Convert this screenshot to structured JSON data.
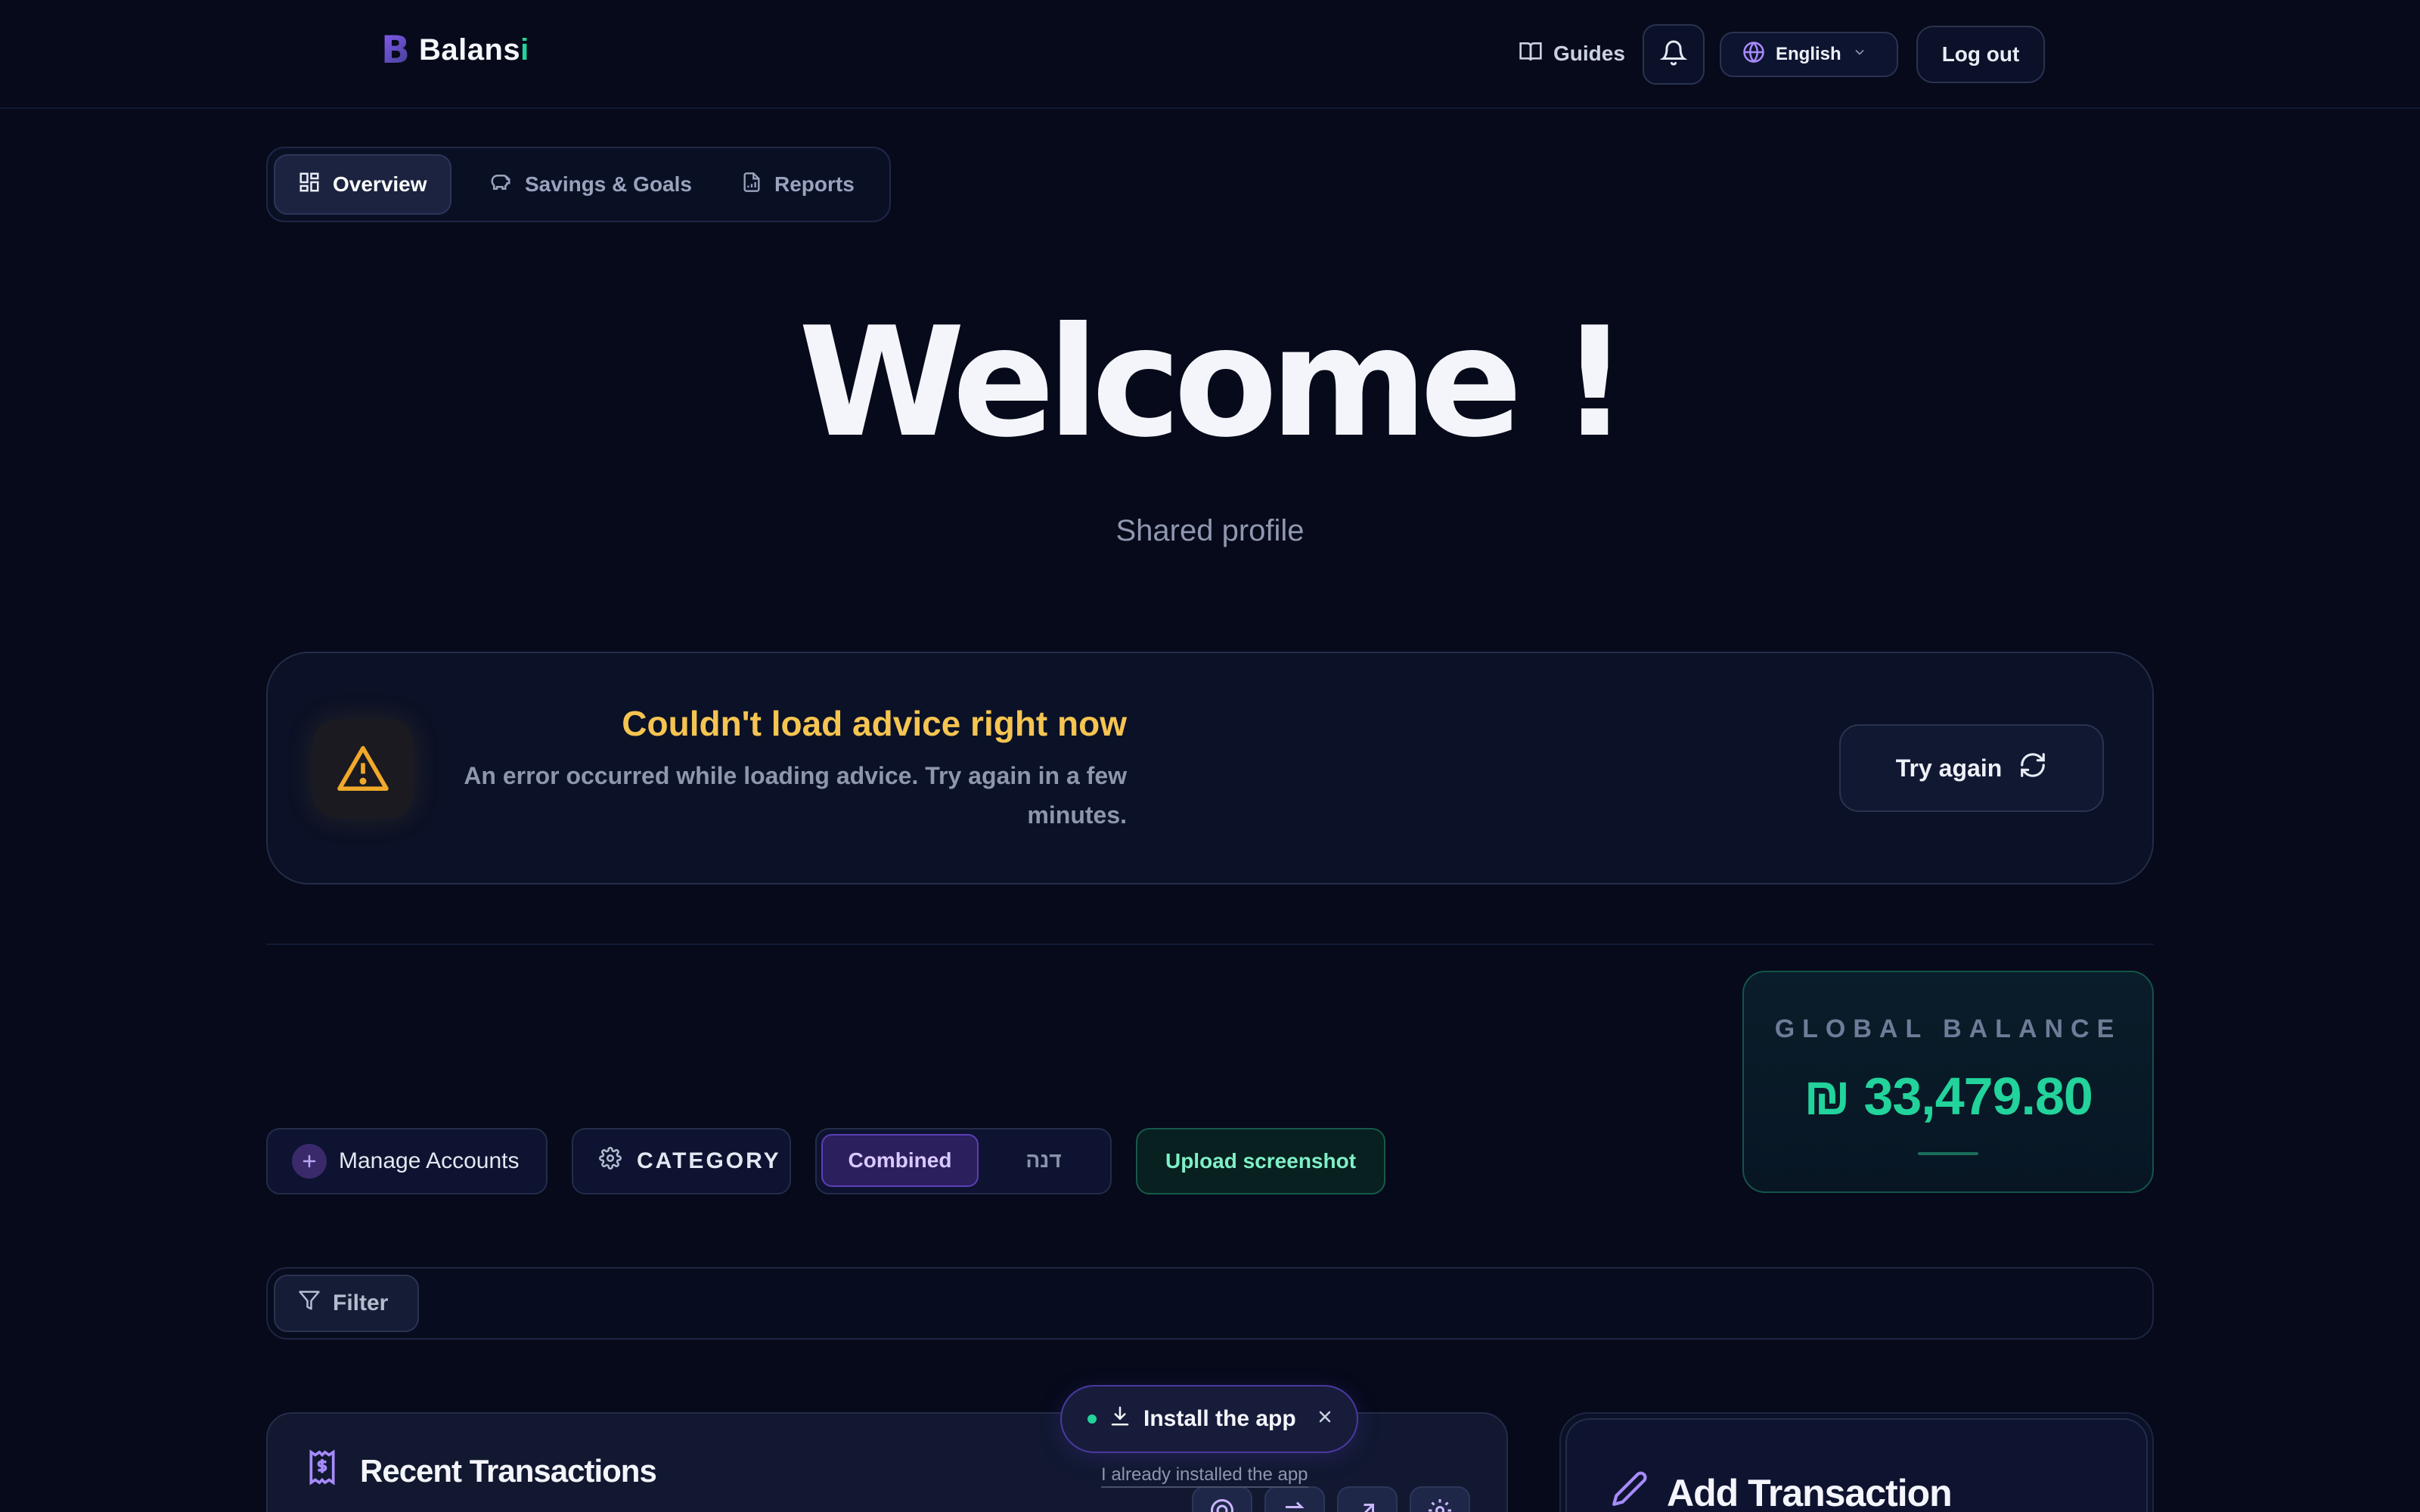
{
  "app": {
    "name": "Balans",
    "name_accent": "i",
    "logo_letter": "B"
  },
  "header": {
    "guides_label": "Guides",
    "language": "English",
    "logout_label": "Log out"
  },
  "tabs": [
    {
      "label": "Overview",
      "active": true
    },
    {
      "label": "Savings & Goals",
      "active": false
    },
    {
      "label": "Reports",
      "active": false
    }
  ],
  "welcome": {
    "title": "Welcome !",
    "subtitle": "Shared profile"
  },
  "advice": {
    "title": "Couldn't load advice right now",
    "message": "An error occurred while loading advice. Try again in a few minutes.",
    "retry_label": "Try again"
  },
  "balance": {
    "label": "GLOBAL BALANCE",
    "value": "₪ 33,479.80"
  },
  "actions": {
    "manage_accounts": "Manage Accounts",
    "category": "CATEGORY",
    "view_toggle": {
      "selected": "Combined",
      "other": "דנה"
    },
    "upload_screenshot": "Upload screenshot"
  },
  "filter": {
    "label": "Filter"
  },
  "recent_transactions": {
    "title": "Recent Transactions"
  },
  "add_transaction": {
    "title": "Add Transaction"
  },
  "install_prompt": {
    "label": "Install the app",
    "already_installed": "I already installed the app"
  },
  "colors": {
    "background": "#060a1a",
    "accent_green": "#22d39b",
    "accent_purple": "#8b5cf6",
    "warning": "#f5c451"
  }
}
